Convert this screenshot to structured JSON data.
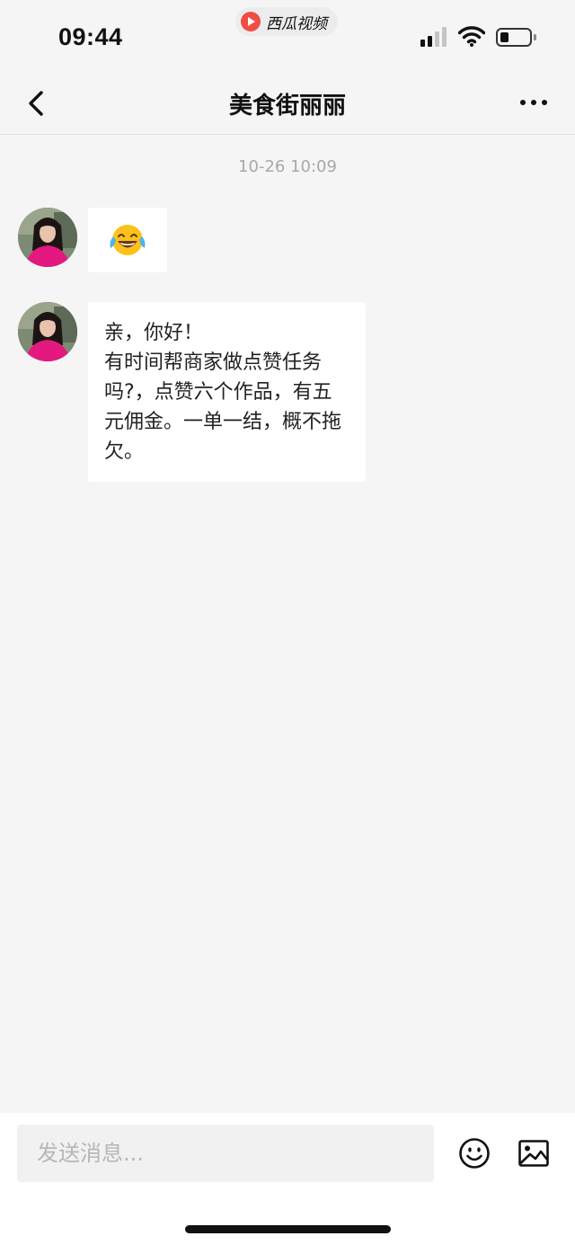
{
  "status_bar": {
    "time": "09:44",
    "app_name": "西瓜视频",
    "app_icon": "play-logo-icon",
    "signal_bars": 2,
    "signal_bars_total": 4,
    "battery_level": 0.25
  },
  "header": {
    "back_icon": "chevron-left-icon",
    "title": "美食街丽丽",
    "more_icon": "ellipsis-icon"
  },
  "chat": {
    "timestamp": "10-26 10:09",
    "messages": [
      {
        "type": "emoji",
        "content": "😂",
        "sender": "avatar"
      },
      {
        "type": "text",
        "content": "亲，你好！\n有时间帮商家做点赞任务吗?，点赞六个作品，有五元佣金。一单一结，概不拖欠。",
        "sender": "avatar"
      }
    ]
  },
  "input": {
    "placeholder": "发送消息...",
    "emoji_icon": "smiley-icon",
    "image_icon": "image-icon"
  },
  "colors": {
    "background": "#f5f5f5",
    "bubble": "#ffffff",
    "timestamp": "#a8a8a8",
    "app_logo": "#f04d46",
    "avatar_shirt": "#e3197f"
  }
}
